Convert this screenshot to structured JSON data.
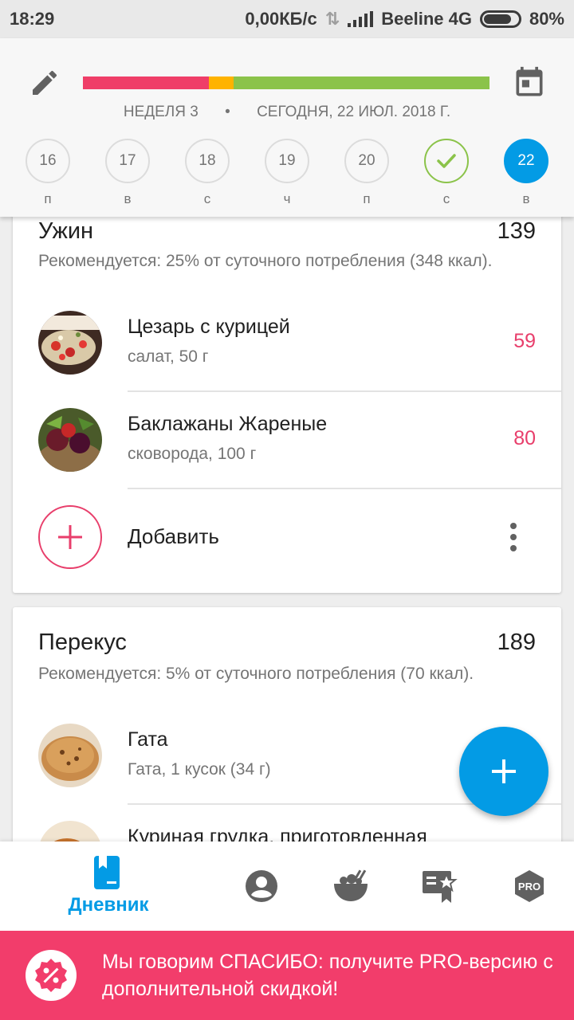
{
  "status_bar": {
    "time": "18:29",
    "network_speed": "0,00КБ/с",
    "carrier": "Beeline 4G",
    "battery": "80%"
  },
  "header": {
    "icons": {
      "left": "pencil-icon",
      "right": "calendar-icon"
    },
    "progress_segments": [
      {
        "color": "#ef3e68",
        "fraction": 0.31
      },
      {
        "color": "#ffb300",
        "fraction": 0.06
      },
      {
        "color": "#8bc34a",
        "fraction": 0.63
      }
    ],
    "week_label": "НЕДЕЛЯ 3",
    "separator": "•",
    "date_label": "СЕГОДНЯ, 22 ИЮЛ. 2018 Г.",
    "days": [
      {
        "num": "16",
        "wd": "п",
        "state": "normal"
      },
      {
        "num": "17",
        "wd": "в",
        "state": "normal"
      },
      {
        "num": "18",
        "wd": "с",
        "state": "normal"
      },
      {
        "num": "19",
        "wd": "ч",
        "state": "normal"
      },
      {
        "num": "20",
        "wd": "п",
        "state": "normal"
      },
      {
        "num": "",
        "wd": "с",
        "state": "done"
      },
      {
        "num": "22",
        "wd": "в",
        "state": "today"
      }
    ]
  },
  "dinner": {
    "title": "Ужин",
    "kcal": "139",
    "recommendation": "Рекомендуется: 25% от суточного потребления (348 ккал).",
    "items": [
      {
        "name": "Цезарь с курицей",
        "sub": "салат, 50 г",
        "kcal": "59"
      },
      {
        "name": "Баклажаны Жареные",
        "sub": "сковорода, 100 г",
        "kcal": "80"
      }
    ],
    "add_label": "Добавить"
  },
  "snack": {
    "title": "Перекус",
    "kcal": "189",
    "recommendation": "Рекомендуется: 5% от суточного потребления (70 ккал).",
    "items": [
      {
        "name": "Гата",
        "sub": "Гата, 1 кусок (34 г)",
        "kcal": ""
      },
      {
        "name": "Куриная грудка, приготовленная",
        "sub": "",
        "kcal": ""
      }
    ]
  },
  "bottom_nav": {
    "items": [
      {
        "icon": "diary-icon",
        "label": "Дневник",
        "active": true
      },
      {
        "icon": "profile-icon",
        "label": "",
        "active": false
      },
      {
        "icon": "food-bowl-icon",
        "label": "",
        "active": false
      },
      {
        "icon": "achievements-icon",
        "label": "",
        "active": false
      },
      {
        "icon": "pro-icon",
        "label": "PRO",
        "active": false
      }
    ]
  },
  "promo": {
    "text": "Мы говорим СПАСИБО: получите PRO-версию с дополнительной скидкой!",
    "icon": "discount-icon"
  },
  "colors": {
    "accent_blue": "#039be5",
    "kcal_pink": "#e83e6b",
    "promo_bg": "#f23d6b",
    "check_green": "#8bc34a"
  }
}
